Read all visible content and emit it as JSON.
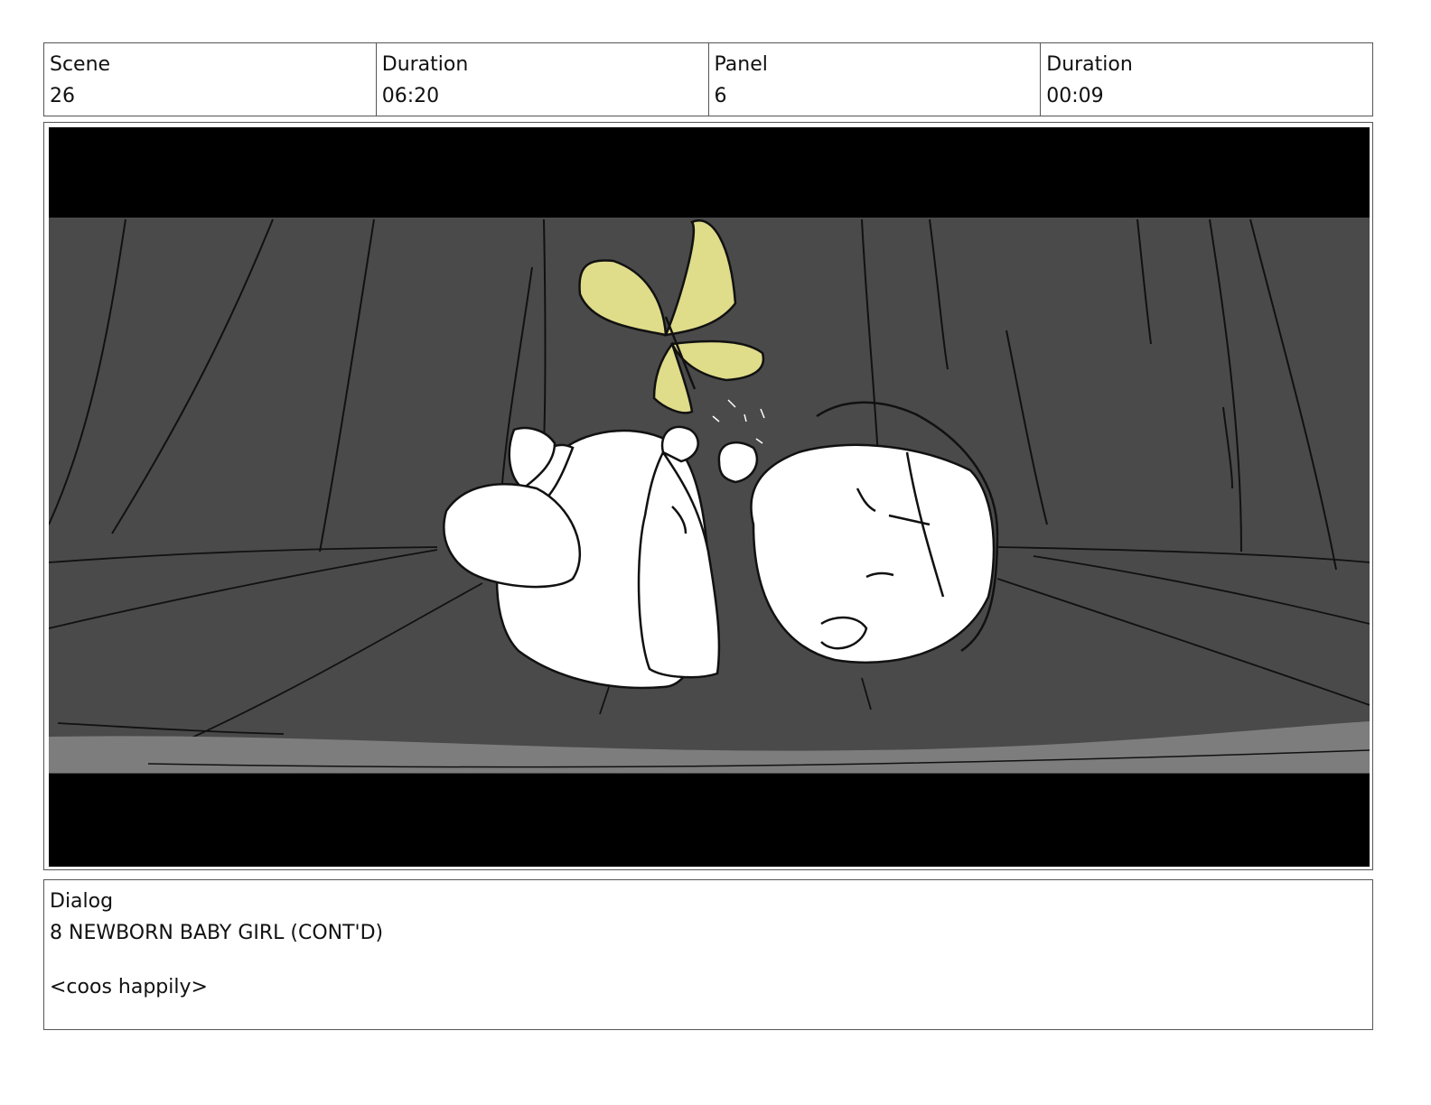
{
  "header": {
    "scene_label": "Scene",
    "scene_value": "26",
    "duration_label": "Duration",
    "duration_value": "06:20",
    "panel_label": "Panel",
    "panel_value": "6",
    "panel_duration_label": "Duration",
    "panel_duration_value": "00:09"
  },
  "panel": {
    "colors": {
      "letterbox": "#000000",
      "background": "#4a4a4a",
      "floor_band": "#7d7d7d",
      "butterfly": "#dfdc8a",
      "baby": "#ffffff"
    }
  },
  "dialog": {
    "label": "Dialog",
    "speaker": "8 NEWBORN BABY GIRL (CONT'D)",
    "line": "<coos happily>"
  }
}
